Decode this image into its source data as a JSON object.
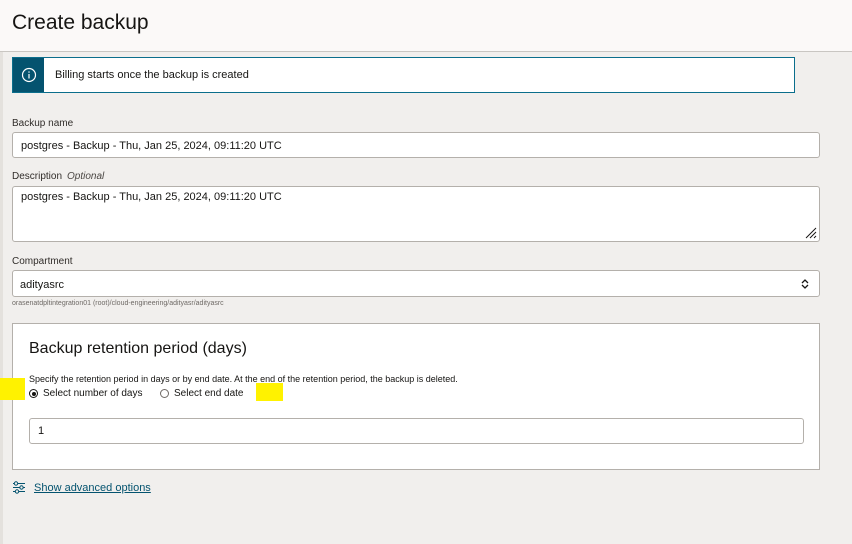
{
  "header": {
    "title": "Create backup"
  },
  "banner": {
    "icon": "info-icon",
    "text": "Billing starts once the backup is created"
  },
  "backup_name": {
    "label": "Backup name",
    "value": "postgres - Backup - Thu, Jan 25, 2024, 09:11:20 UTC"
  },
  "description": {
    "label": "Description",
    "optional": "Optional",
    "value": "postgres - Backup - Thu, Jan 25, 2024, 09:11:20 UTC"
  },
  "compartment": {
    "label": "Compartment",
    "value": "adityasrc",
    "path": "orasenatdpltintegration01 (root)/cloud-engineering/adityasr/adityasrc"
  },
  "retention": {
    "title": "Backup retention period (days)",
    "description": "Specify the retention period in days or by end date. At the end of the retention period, the backup is deleted.",
    "options": [
      {
        "label": "Select number of days",
        "checked": true
      },
      {
        "label": "Select end date",
        "checked": false
      }
    ],
    "days_value": "1"
  },
  "advanced": {
    "link": "Show advanced options",
    "icon": "sliders-icon"
  },
  "colors": {
    "accent": "#04536f",
    "highlight": "#fff200",
    "background": "#f1efed"
  }
}
